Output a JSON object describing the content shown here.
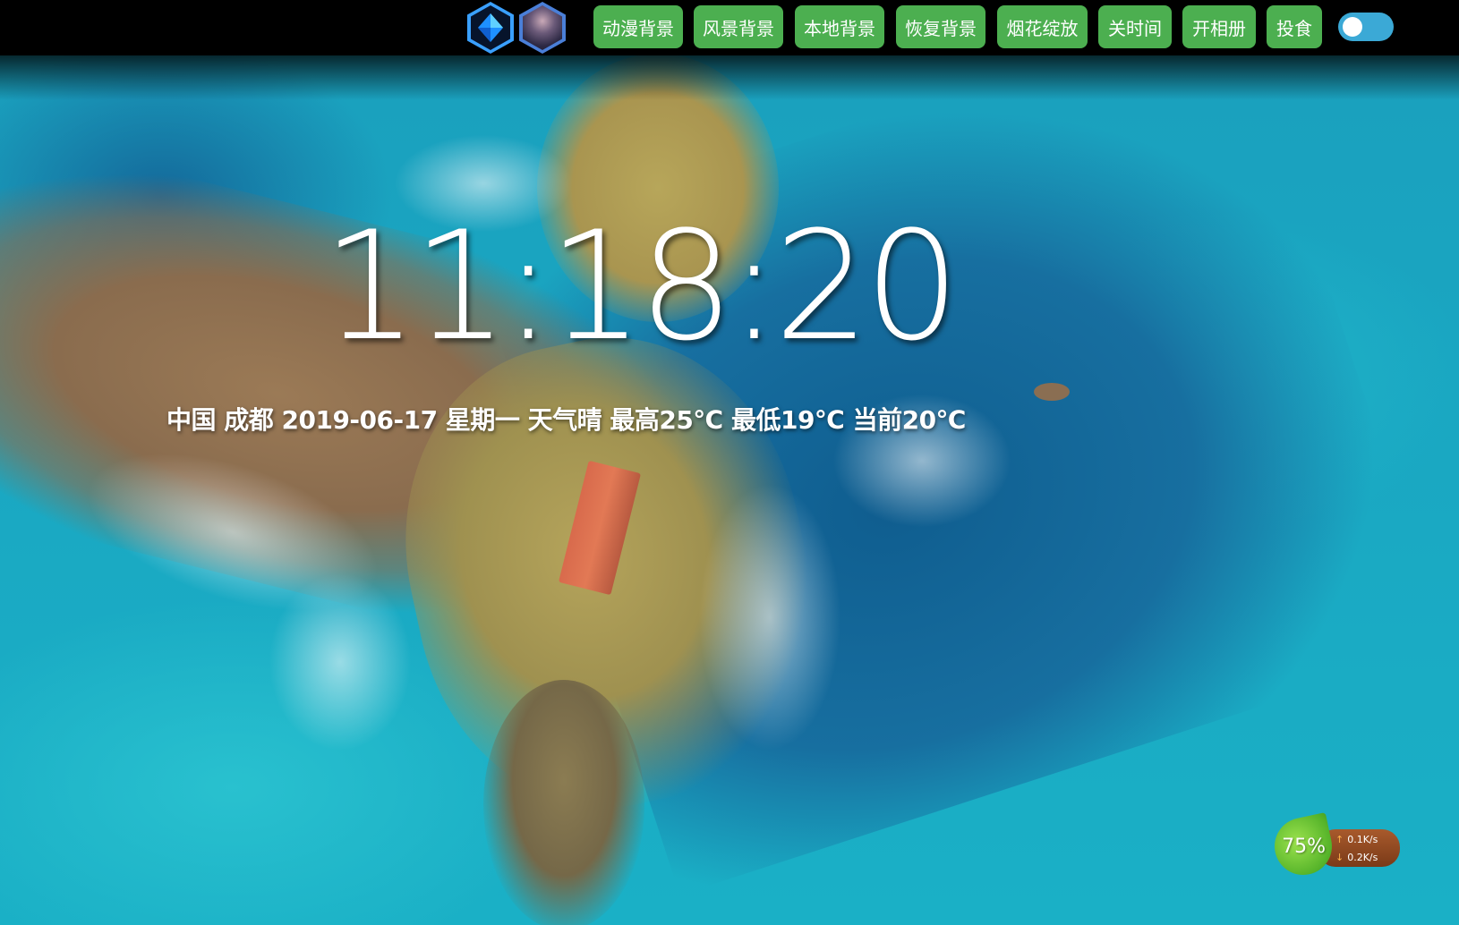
{
  "menu": {
    "items": [
      {
        "label": "动漫背景"
      },
      {
        "label": "风景背景"
      },
      {
        "label": "本地背景"
      },
      {
        "label": "恢复背景"
      },
      {
        "label": "烟花绽放"
      },
      {
        "label": "关时间"
      },
      {
        "label": "开相册"
      },
      {
        "label": "投食"
      }
    ],
    "button_color": "#4caf50",
    "toggle_color": "#3ba9d6"
  },
  "header": {
    "logo_icon": "diamond-logo-icon",
    "avatar_icon": "user-avatar"
  },
  "clock": {
    "time": "11:18:20"
  },
  "weather": {
    "text": "中国 成都 2019-06-17 星期一 天气晴 最高25℃ 最低19℃ 当前20℃"
  },
  "network": {
    "percent": "75%",
    "upload": "0.1K/s",
    "download": "0.2K/s"
  }
}
